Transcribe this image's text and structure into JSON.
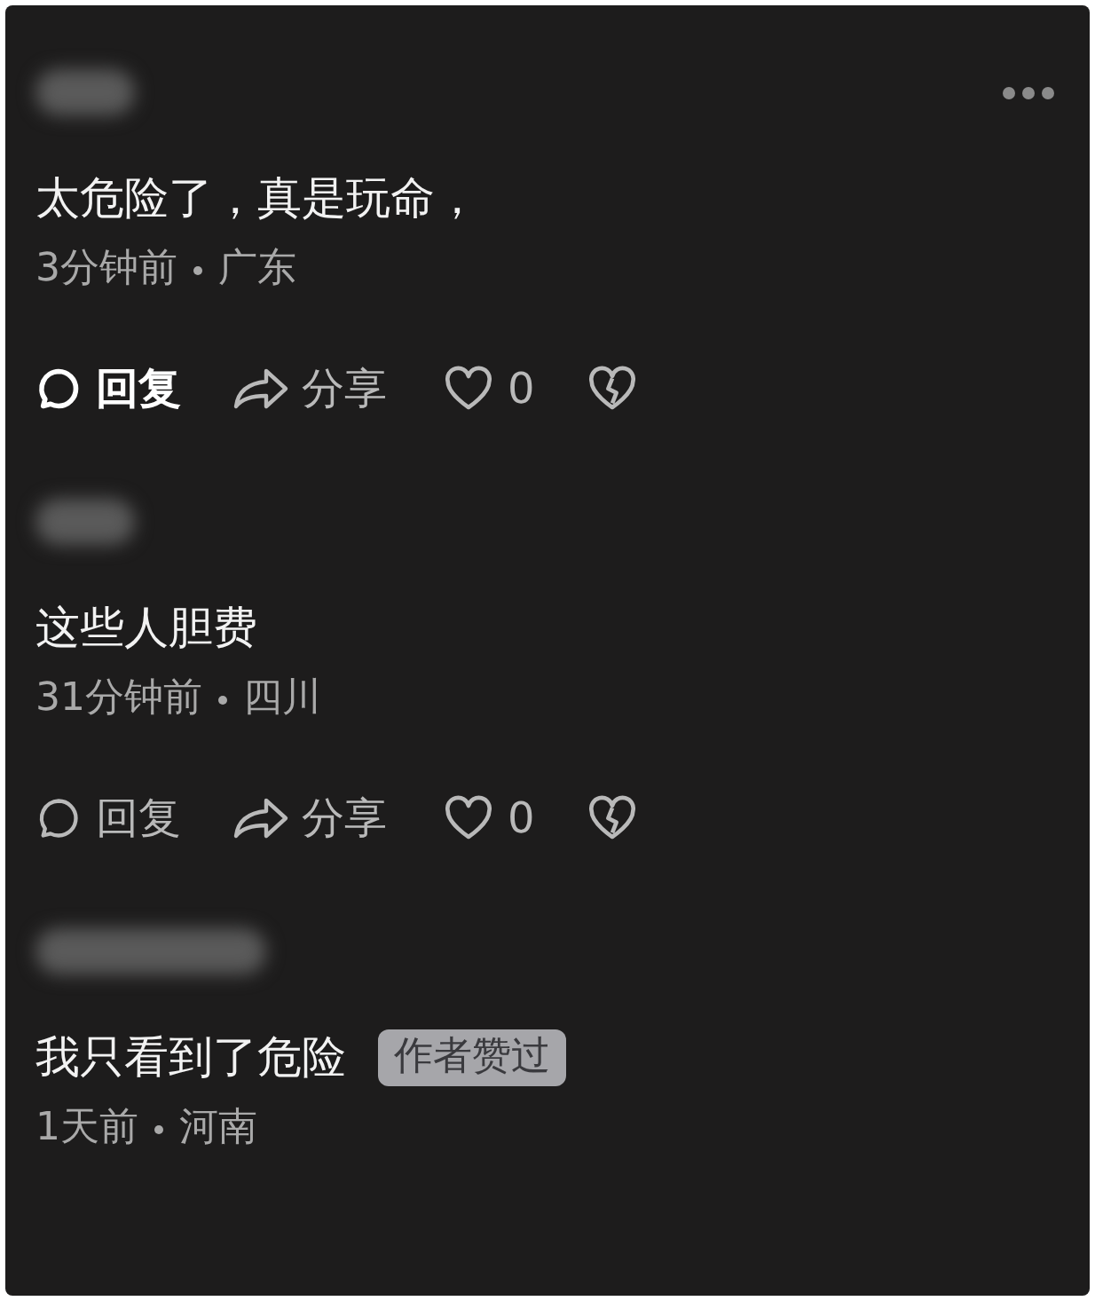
{
  "comments": [
    {
      "text": "太危险了，真是玩命，",
      "time": "3分钟前",
      "region": "广东",
      "more_menu": true,
      "actions": {
        "reply": "回复",
        "share": "分享",
        "likes": "0",
        "reply_active": true
      }
    },
    {
      "text": "这些人胆费",
      "time": "31分钟前",
      "region": "四川",
      "more_menu": false,
      "actions": {
        "reply": "回复",
        "share": "分享",
        "likes": "0",
        "reply_active": false
      }
    },
    {
      "text": "我只看到了危险",
      "time": "1天前",
      "region": "河南",
      "badge": "作者赞过",
      "more_menu": false
    }
  ]
}
